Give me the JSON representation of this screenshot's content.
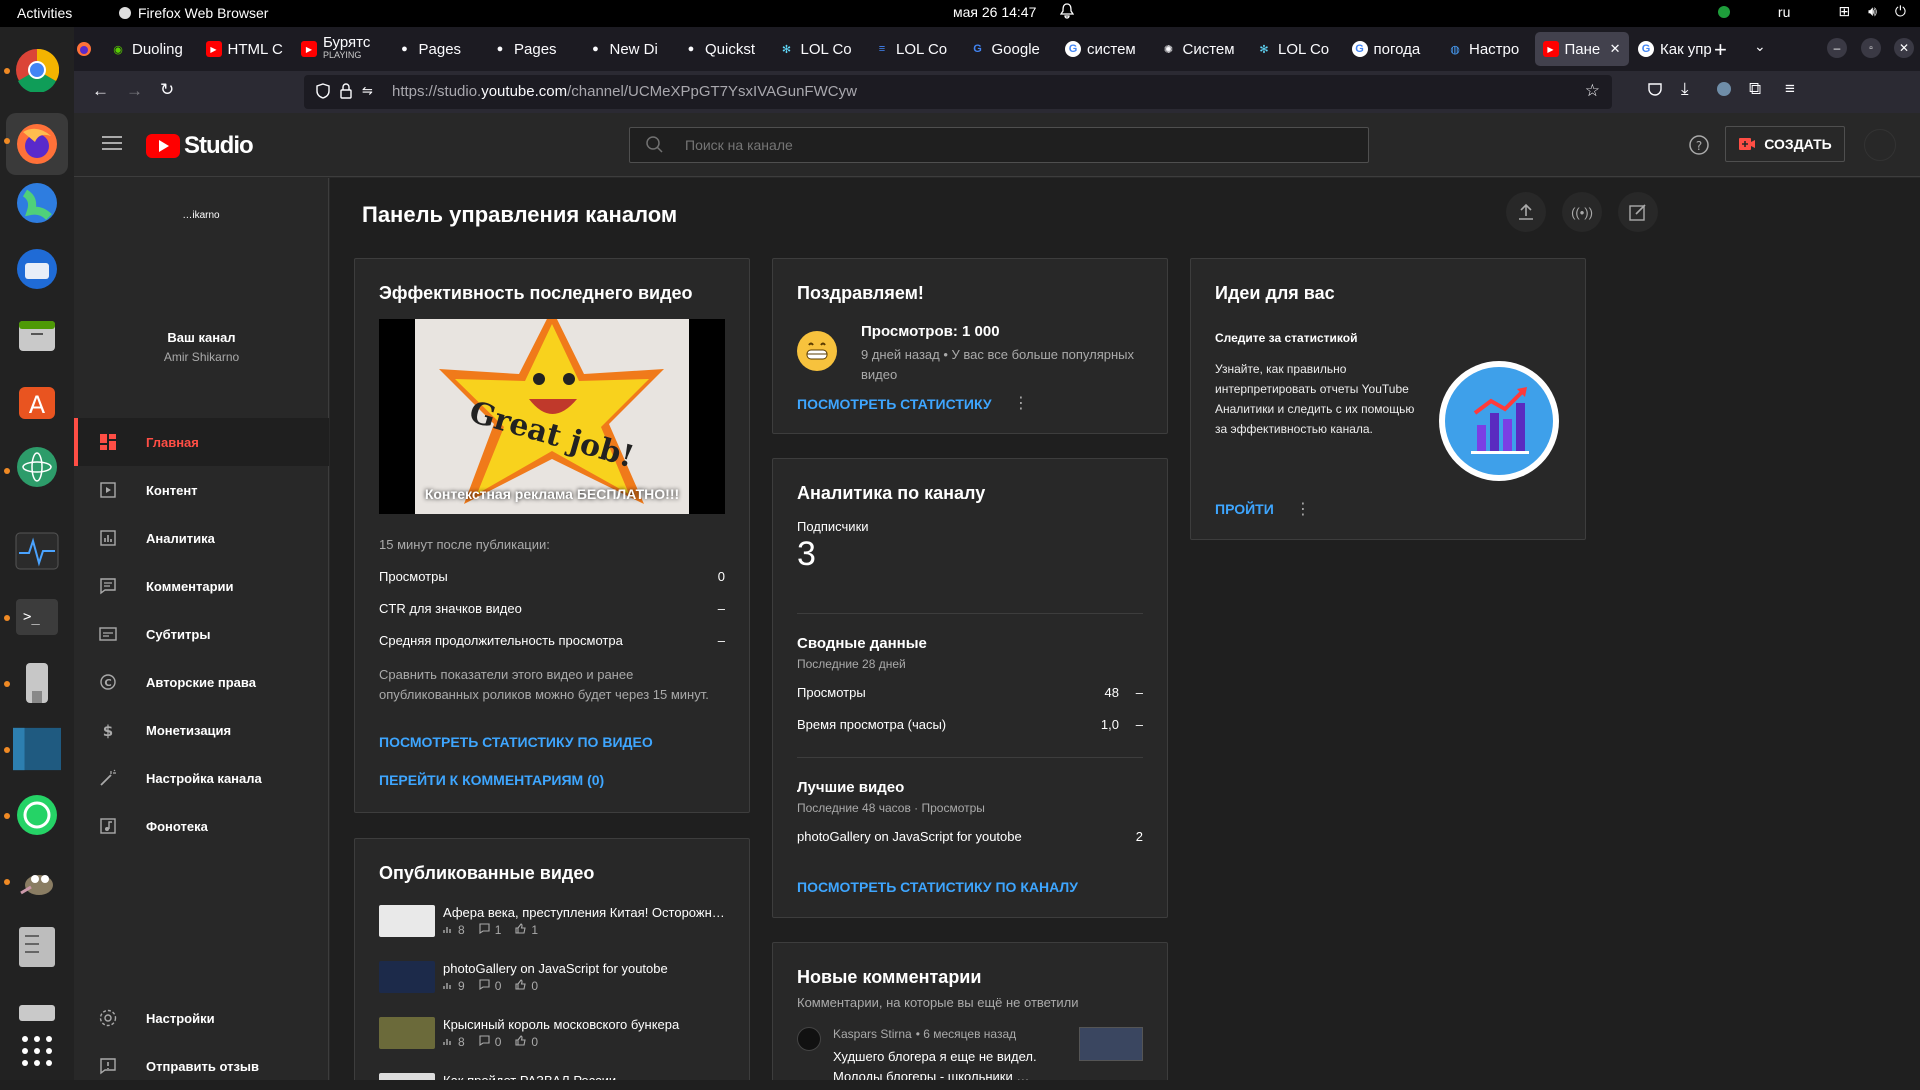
{
  "os_bar": {
    "activities": "Activities",
    "app_name": "Firefox Web Browser",
    "clock": "мая 26  14:47",
    "lang": "ru"
  },
  "tabs": [
    {
      "label": "Duoling",
      "fav": "duo"
    },
    {
      "label": "HTML C",
      "fav": "yt"
    },
    {
      "label": "Бурятс",
      "sub": "PLAYING",
      "fav": "yt"
    },
    {
      "label": "Pages",
      "fav": "gh"
    },
    {
      "label": "Pages",
      "fav": "gh"
    },
    {
      "label": "New Di",
      "fav": "gh"
    },
    {
      "label": "Quickst",
      "fav": "gh"
    },
    {
      "label": "LOL Co",
      "fav": "react"
    },
    {
      "label": "LOL Co",
      "fav": "doc"
    },
    {
      "label": "Google",
      "fav": "gtrans"
    },
    {
      "label": "систем",
      "fav": "g"
    },
    {
      "label": "Систем",
      "fav": "gpt"
    },
    {
      "label": "LOL Co",
      "fav": "react"
    },
    {
      "label": "погода",
      "fav": "g"
    },
    {
      "label": "Настро",
      "fav": "globe"
    },
    {
      "label": "Пане",
      "fav": "yt",
      "active": true
    },
    {
      "label": "Как упр",
      "fav": "g"
    }
  ],
  "url": {
    "prefix": "https://studio.",
    "domain": "youtube.com",
    "path": "/channel/UCMeXPpGT7YsxIVAGunFWCyw"
  },
  "studio": {
    "logo_text": "Studio",
    "search_placeholder": "Поиск на канале",
    "create_label": "СОЗДАТЬ"
  },
  "channel": {
    "avatar_text": "…ikarno",
    "label": "Ваш канал",
    "name": "Amir Shikarno"
  },
  "sidebar": {
    "items": [
      {
        "label": "Главная",
        "icon": "dashboard-icon",
        "active": true
      },
      {
        "label": "Контент",
        "icon": "content-icon"
      },
      {
        "label": "Аналитика",
        "icon": "analytics-icon"
      },
      {
        "label": "Комментарии",
        "icon": "comments-icon"
      },
      {
        "label": "Субтитры",
        "icon": "subtitles-icon"
      },
      {
        "label": "Авторские права",
        "icon": "copyright-icon"
      },
      {
        "label": "Монетизация",
        "icon": "monetization-icon"
      },
      {
        "label": "Настройка канала",
        "icon": "customization-icon"
      },
      {
        "label": "Фонотека",
        "icon": "audio-library-icon"
      }
    ],
    "bottom": [
      {
        "label": "Настройки",
        "icon": "settings-icon"
      },
      {
        "label": "Отправить отзыв",
        "icon": "feedback-icon"
      }
    ]
  },
  "dashboard": {
    "title": "Панель управления каналом",
    "latest": {
      "title": "Эффективность последнего видео",
      "thumb_caption": "Контекстная реклама БЕСПЛАТНО!!!",
      "thumb_text": "Great job!",
      "since": "15 минут после публикации:",
      "rows": [
        {
          "label": "Просмотры",
          "value": "0"
        },
        {
          "label": "CTR для значков видео",
          "value": "–"
        },
        {
          "label": "Средняя продолжительность просмотра",
          "value": "–"
        }
      ],
      "note": "Сравнить показатели этого видео и ранее опубликованных роликов можно будет через 15 минут.",
      "link_stats": "ПОСМОТРЕТЬ СТАТИСТИКУ ПО ВИДЕО",
      "link_comments": "ПЕРЕЙТИ К КОММЕНТАРИЯМ (0)"
    },
    "published": {
      "title": "Опубликованные видео",
      "videos": [
        {
          "title": "Афера века, преступления Китая! Осторожн…",
          "views": "8",
          "comments": "1",
          "likes": "1",
          "thumb": "#e9e9e9"
        },
        {
          "title": "photoGallery on JavaScript for youtobe",
          "views": "9",
          "comments": "0",
          "likes": "0",
          "thumb": "#1c2a4a"
        },
        {
          "title": "Крысиный король московского бункера",
          "views": "8",
          "comments": "0",
          "likes": "0",
          "thumb": "#6b6a3a"
        },
        {
          "title": "Как пройдет РАЗВАЛ России",
          "views": "",
          "comments": "",
          "likes": "",
          "thumb": "#dddddd"
        }
      ]
    },
    "congrats": {
      "title": "Поздравляем!",
      "headline": "Просмотров: 1 000",
      "meta": "9 дней назад • У вас все больше популярных видео",
      "link": "ПОСМОТРЕТЬ СТАТИСТИКУ"
    },
    "analytics": {
      "title": "Аналитика по каналу",
      "subs_label": "Подписчики",
      "subs_value": "3",
      "summary_title": "Сводные данные",
      "summary_period": "Последние 28 дней",
      "summary_rows": [
        {
          "label": "Просмотры",
          "value": "48",
          "trend": "–"
        },
        {
          "label": "Время просмотра (часы)",
          "value": "1,0",
          "trend": "–"
        }
      ],
      "top_title": "Лучшие видео",
      "top_period": "Последние 48 часов · Просмотры",
      "top_rows": [
        {
          "label": "photoGallery on JavaScript for youtobe",
          "value": "2"
        }
      ],
      "link": "ПОСМОТРЕТЬ СТАТИСТИКУ ПО КАНАЛУ"
    },
    "comments": {
      "title": "Новые комментарии",
      "subtitle": "Комментарии, на которые вы ещё не ответили",
      "items": [
        {
          "author": "Kaspars Stirna",
          "time": "• 6 месяцев назад",
          "text": "Худшего блогера я еще не видел.",
          "text2": "Молоды блогеры - школьники …"
        }
      ]
    },
    "ideas": {
      "title": "Идеи для вас",
      "subtitle": "Следите за статистикой",
      "text": "Узнайте, как правильно интерпретировать отчеты YouTube Аналитики и следить с их помощью за эффективностью канала.",
      "link": "ПРОЙТИ"
    }
  },
  "colors": {
    "accent": "#ff4e45",
    "link": "#3ea6ff",
    "card": "#282828",
    "bg": "#1f1f1f"
  }
}
